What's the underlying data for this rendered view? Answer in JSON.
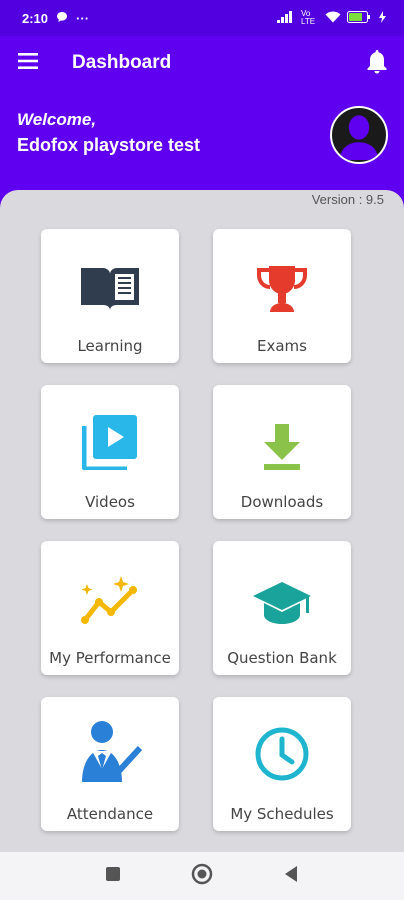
{
  "status_bar": {
    "time": "2:10",
    "dots": "···",
    "network_label": "Vo LTE"
  },
  "app_bar": {
    "title": "Dashboard",
    "menu_icon": "menu-icon",
    "notification_icon": "bell-icon"
  },
  "welcome": {
    "label": "Welcome,",
    "name": "Edofox playstore test"
  },
  "version": "Version : 9.5",
  "tiles": [
    {
      "label": "Learning",
      "icon": "book-icon",
      "color": "#2f3d4f"
    },
    {
      "label": "Exams",
      "icon": "trophy-icon",
      "color": "#e53b2c"
    },
    {
      "label": "Videos",
      "icon": "video-library-icon",
      "color": "#29b6e8"
    },
    {
      "label": "Downloads",
      "icon": "download-icon",
      "color": "#8bc34a"
    },
    {
      "label": "My Performance",
      "icon": "performance-icon",
      "color": "#f5b800"
    },
    {
      "label": "Question Bank",
      "icon": "graduation-cap-icon",
      "color": "#1aa39a"
    },
    {
      "label": "Attendance",
      "icon": "attendance-icon",
      "color": "#2a7fd6"
    },
    {
      "label": "My Schedules",
      "icon": "clock-icon",
      "color": "#1fb5cf"
    }
  ],
  "system_nav": {
    "recents_icon": "square-icon",
    "home_icon": "home-circle-icon",
    "back_icon": "back-triangle-icon"
  },
  "colors": {
    "primary": "#6000f0",
    "panel": "#dadade"
  }
}
